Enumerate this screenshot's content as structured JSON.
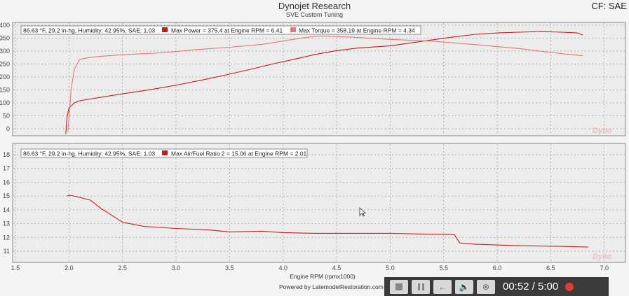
{
  "header": {
    "title": "Dynojet Research",
    "subtitle": "SVE Custom Tuning",
    "correction": "CF: SAE Sm"
  },
  "top_legend": {
    "conditions": "86.63 °F, 29.2 in-hg, Humidity: 42.95%, SAE: 1.03",
    "power": "Max Power = 375.4 at Engine RPM = 6.41",
    "torque": "Max Torque = 358.19 at Engine RPM = 4.34"
  },
  "bottom_legend": {
    "conditions": "86.63 °F, 29.2 in-hg, Humidity: 42.95%, SAE: 1.03",
    "afr": "Max Air/Fuel Ratio 2 = 15.06 at Engine RPM = 2.01"
  },
  "footer": "Powered by LatemodelRestoration.com",
  "player": {
    "time": "00:52 / 5:00"
  },
  "colors": {
    "power": "#c81c1c",
    "torque": "#e07878",
    "afr": "#c81c1c",
    "grid": "#9a9a9a",
    "record": "#e53935"
  },
  "chart_data": [
    {
      "type": "line",
      "title": "Dynojet Research",
      "xlabel": "Engine RPM (rpmx1000)",
      "ylabel": "",
      "xlim": [
        1.5,
        7.1
      ],
      "ylim": [
        -30,
        405
      ],
      "yticks": [
        0,
        50,
        100,
        150,
        200,
        250,
        300,
        350,
        400
      ],
      "grid": true,
      "series": [
        {
          "name": "Max Power = 375.4 at Engine RPM = 6.41",
          "x": [
            1.97,
            1.98,
            2.0,
            2.05,
            2.1,
            2.2,
            2.3,
            2.5,
            2.7,
            3.0,
            3.3,
            3.5,
            3.7,
            3.9,
            4.1,
            4.3,
            4.5,
            4.7,
            5.0,
            5.3,
            5.6,
            5.8,
            6.0,
            6.2,
            6.41,
            6.6,
            6.75,
            6.8
          ],
          "y": [
            -20,
            40,
            80,
            100,
            108,
            115,
            122,
            135,
            147,
            168,
            193,
            211,
            230,
            250,
            268,
            287,
            302,
            312,
            320,
            338,
            355,
            365,
            370,
            373,
            375.4,
            373,
            370,
            362
          ]
        },
        {
          "name": "Max Torque = 358.19 at Engine RPM = 4.34",
          "x": [
            1.99,
            2.02,
            2.05,
            2.1,
            2.2,
            2.3,
            2.5,
            2.8,
            3.0,
            3.2,
            3.5,
            3.8,
            4.0,
            4.2,
            4.34,
            4.6,
            5.0,
            5.4,
            5.8,
            6.2,
            6.6,
            6.8
          ],
          "y": [
            -10,
            150,
            230,
            268,
            276,
            280,
            286,
            292,
            298,
            306,
            315,
            326,
            339,
            352,
            358.19,
            355,
            345,
            338,
            325,
            310,
            290,
            282
          ]
        }
      ]
    },
    {
      "type": "line",
      "xlabel": "Engine RPM (rpmx1000)",
      "ylabel": "",
      "xlim": [
        1.5,
        7.1
      ],
      "ylim": [
        9.6,
        18.8
      ],
      "xticks": [
        1.5,
        2.0,
        2.5,
        3.0,
        3.5,
        4.0,
        4.5,
        5.0,
        5.5,
        6.0,
        6.5,
        7.0
      ],
      "yticks": [
        11,
        12,
        13,
        14,
        15,
        16,
        17,
        18
      ],
      "grid": true,
      "series": [
        {
          "name": "Max Air/Fuel Ratio 2 = 15.06 at Engine RPM = 2.01",
          "x": [
            1.98,
            2.01,
            2.1,
            2.2,
            2.3,
            2.4,
            2.5,
            2.7,
            3.0,
            3.3,
            3.5,
            3.8,
            4.0,
            4.3,
            4.6,
            5.0,
            5.3,
            5.6,
            5.65,
            5.8,
            6.2,
            6.6,
            6.85
          ],
          "y": [
            15.0,
            15.06,
            14.9,
            14.7,
            14.1,
            13.6,
            13.1,
            12.8,
            12.65,
            12.55,
            12.4,
            12.45,
            12.35,
            12.3,
            12.3,
            12.3,
            12.25,
            12.2,
            11.6,
            11.5,
            11.4,
            11.35,
            11.3
          ]
        }
      ]
    }
  ]
}
